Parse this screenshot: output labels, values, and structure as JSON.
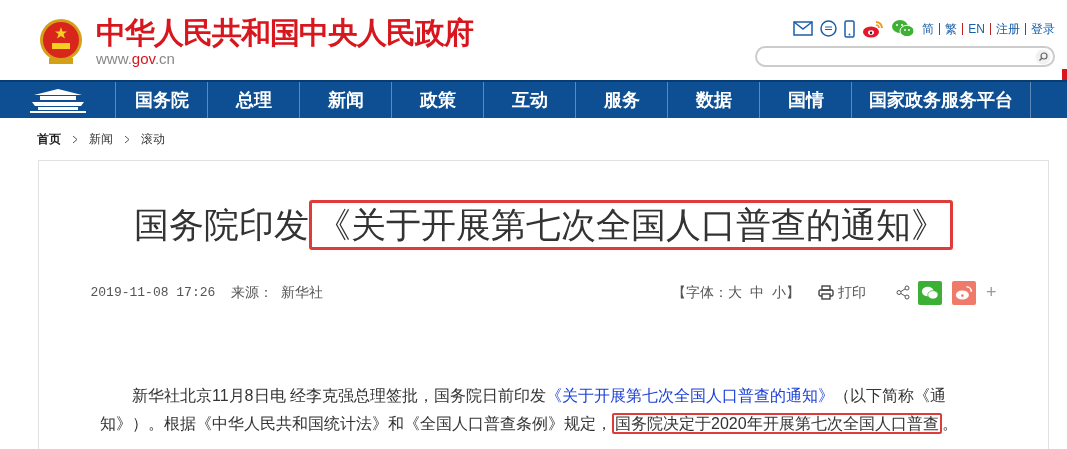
{
  "header": {
    "site_title": "中华人民共和国中央人民政府",
    "site_url_parts": [
      {
        "text": "www.",
        "kind": "plain"
      },
      {
        "text": "gov",
        "kind": "accent"
      },
      {
        "text": ".cn",
        "kind": "plain"
      }
    ],
    "top_links": [
      {
        "label": "简"
      },
      {
        "label": "繁"
      },
      {
        "label": "EN"
      },
      {
        "label": "注册"
      },
      {
        "label": "登录"
      }
    ]
  },
  "nav": {
    "items": [
      {
        "label": "国务院"
      },
      {
        "label": "总理"
      },
      {
        "label": "新闻"
      },
      {
        "label": "政策"
      },
      {
        "label": "互动"
      },
      {
        "label": "服务"
      },
      {
        "label": "数据"
      },
      {
        "label": "国情"
      },
      {
        "label": "国家政务服务平台"
      }
    ]
  },
  "breadcrumb": [
    {
      "label": "首页"
    },
    {
      "label": "新闻"
    },
    {
      "label": "滚动"
    }
  ],
  "article": {
    "title_parts": [
      {
        "text": "国务院印发",
        "highlighted": false
      },
      {
        "text": "《关于开展第七次全国人口普查的通知》",
        "highlighted": true
      }
    ],
    "date": "2019-11-08 17:26",
    "source_label": "来源：",
    "source": "新华社",
    "font_size_label_open": "【字体：",
    "font_sizes": [
      "大",
      "中",
      "小"
    ],
    "font_size_label_close": "】",
    "print": "打印",
    "more": "+",
    "paragraph": [
      {
        "kind": "text",
        "text": "新华社北京11月8日电 经李克强总理签批，国务院日前印发",
        "highlighted": false
      },
      {
        "kind": "link",
        "text": "《关于开展第七次全国人口普查的通知》",
        "highlighted": false
      },
      {
        "kind": "text",
        "text": "（以下简称《通知》）。根据《中华人民共和国统计法》和《全国人口普查条例》规定，",
        "highlighted": false
      },
      {
        "kind": "text",
        "text": "国务院决定于2020年开展第七次全国人口普查",
        "highlighted": true
      },
      {
        "kind": "text",
        "text": "。",
        "highlighted": false
      }
    ]
  }
}
